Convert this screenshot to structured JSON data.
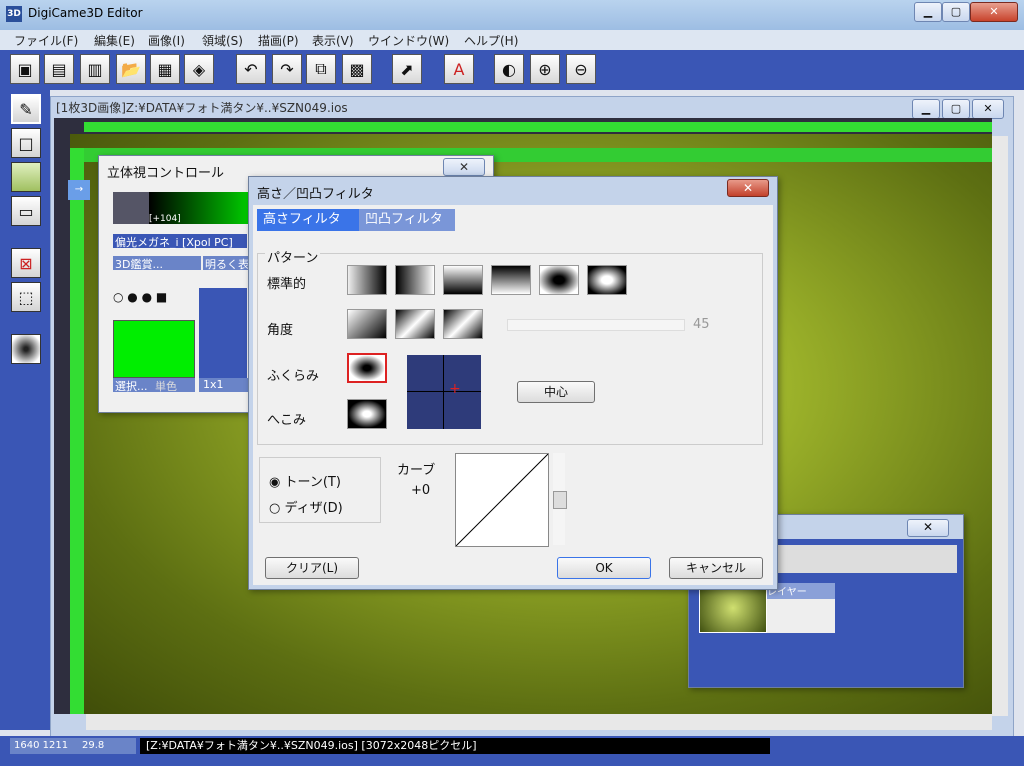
{
  "window": {
    "app_icon": "3D",
    "title": "DigiCame3D Editor",
    "min": "▁",
    "max": "▢",
    "close": "✕"
  },
  "menu": [
    "ファイル(F)",
    "編集(E)",
    "画像(I)",
    "領域(S)",
    "描画(P)",
    "表示(V)",
    "ウインドウ(W)",
    "ヘルプ(H)"
  ],
  "toolbar_icons": [
    "new-image-icon",
    "new-3d-icon",
    "new-layer-icon",
    "open-icon",
    "save-icon",
    "print-icon",
    "undo-icon",
    "redo-icon",
    "copy-icon",
    "paste-icon",
    "select-tool-icon",
    "text-abc-icon",
    "stereo-view-icon",
    "zoom-in-icon",
    "zoom-out-icon"
  ],
  "document": {
    "title": "[1枚3D画像]Z:¥DATA¥フォト満タン¥..¥SZN049.ios"
  },
  "stereo_panel": {
    "title": "立体視コントロール",
    "value": "[+104]",
    "glasses": "偏光メガネ_i [Xpol PC]",
    "btn_view": "3D鑑賞...",
    "btn_bright": "明るく表",
    "select_label": "選択...",
    "mono_label": "単色",
    "size_label": "1x1"
  },
  "filter_dialog": {
    "title": "高さ／凹凸フィルタ",
    "tab_height": "高さフィルタ",
    "tab_bump": "凹凸フィルタ",
    "group_pattern": "パターン",
    "row_standard": "標準的",
    "row_angle": "角度",
    "row_bulge": "ふくらみ",
    "row_dent": "へこみ",
    "angle_value": "45",
    "center_button": "中心",
    "radio_tone": "トーン(T)",
    "radio_dither": "ディザ(D)",
    "curve_label": "カーブ",
    "curve_value": "+0",
    "clear_button": "クリア(L)",
    "ok_button": "OK",
    "cancel_button": "キャンセル"
  },
  "layer_panel": {
    "label": "レイヤー"
  },
  "status": {
    "coords": "1640 1211",
    "zoom": "29.8",
    "path": "[Z:¥DATA¥フォト満タン¥..¥SZN049.ios] [3072x2048ピクセル]"
  }
}
